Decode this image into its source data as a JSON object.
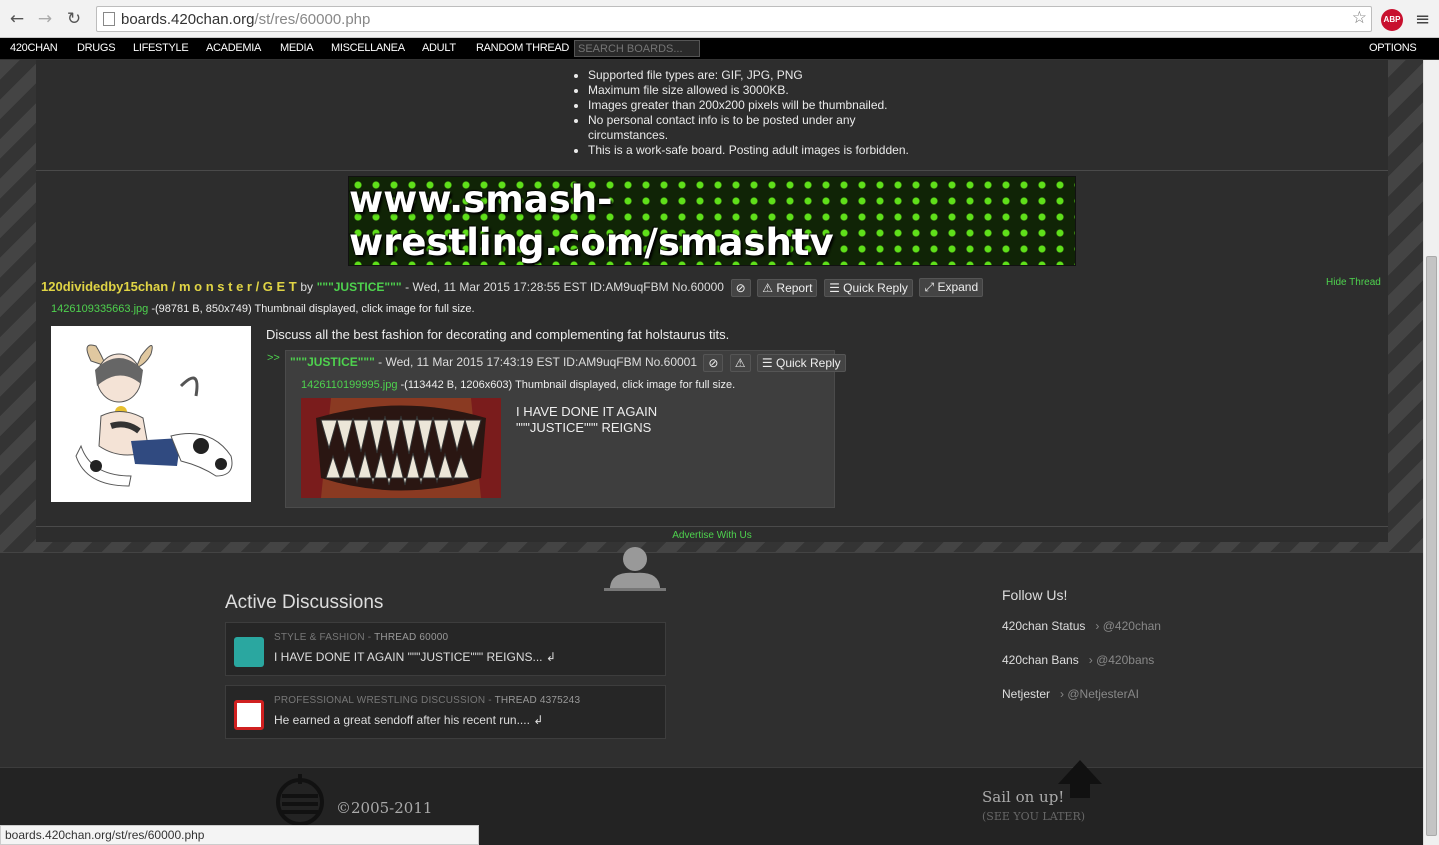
{
  "browser": {
    "url_host": "boards.420chan.org",
    "url_path": "/st/res/60000.php",
    "abp_label": "ABP"
  },
  "nav": {
    "items": [
      "420CHAN",
      "DRUGS",
      "LIFESTYLE",
      "ACADEMIA",
      "MEDIA",
      "MISCELLANEA",
      "ADULT",
      "RANDOM THREAD"
    ],
    "search_placeholder": "SEARCH BOARDS...",
    "options": "OPTIONS"
  },
  "rules": [
    "Supported file types are: GIF, JPG, PNG",
    "Maximum file size allowed is 3000KB.",
    "Images greater than 200x200 pixels will be thumbnailed.",
    "No personal contact info is to be posted under any circumstances.",
    "This is a work-safe board. Posting adult images is forbidden."
  ],
  "banner_text": "www.smash-wrestling.com/smashtv",
  "op": {
    "subject": "120dividedby15chan / m o n s t e r / G E T",
    "by": "by",
    "name": "\"\"\"JUSTICE\"\"\"",
    "meta": "- Wed, 11 Mar 2015 17:28:55 EST ID:AM9uqFBM No.60000",
    "report": "Report",
    "quick_reply": "Quick Reply",
    "expand": "Expand",
    "hide_thread": "Hide Thread",
    "file_name": "1426109335663.jpg",
    "file_info": " -(98781 B, 850x749) Thumbnail displayed, click image for full size.",
    "message": "Discuss all the best fashion for decorating and complementing fat holstaurus tits."
  },
  "reply": {
    "arrows": ">>",
    "name": "\"\"\"JUSTICE\"\"\"",
    "meta": "- Wed, 11 Mar 2015 17:43:19 EST ID:AM9uqFBM No.60001",
    "quick_reply": "Quick Reply",
    "file_name": "1426110199995.jpg",
    "file_info": " -(113442 B, 1206x603) Thumbnail displayed, click image for full size.",
    "line1": "I HAVE DONE IT AGAIN",
    "line2": "\"\"\"JUSTICE\"\"\" REIGNS"
  },
  "advertise": "Advertise With Us",
  "active": {
    "title": "Active Discussions",
    "items": [
      {
        "cat": "STYLE & FASHION",
        "thread": "THREAD 60000",
        "text": "I HAVE DONE IT AGAIN \"\"\"JUSTICE\"\"\" REIGNS... ↲",
        "color": "#2aa7a0"
      },
      {
        "cat": "PROFESSIONAL WRESTLING DISCUSSION",
        "thread": "THREAD 4375243",
        "text": "He earned a great sendoff after his recent run.... ↲",
        "color": "#d02020"
      }
    ]
  },
  "follow": {
    "title": "Follow Us!",
    "items": [
      {
        "name": "420chan Status",
        "handle": "› @420chan"
      },
      {
        "name": "420chan Bans",
        "handle": "› @420bans"
      },
      {
        "name": "Netjester",
        "handle": "› @NetjesterAI"
      }
    ]
  },
  "footer": {
    "copyright": "©2005-2011",
    "sail": "Sail on up!",
    "see_later": "(SEE YOU LATER)"
  },
  "status_url": "boards.420chan.org/st/res/60000.php"
}
